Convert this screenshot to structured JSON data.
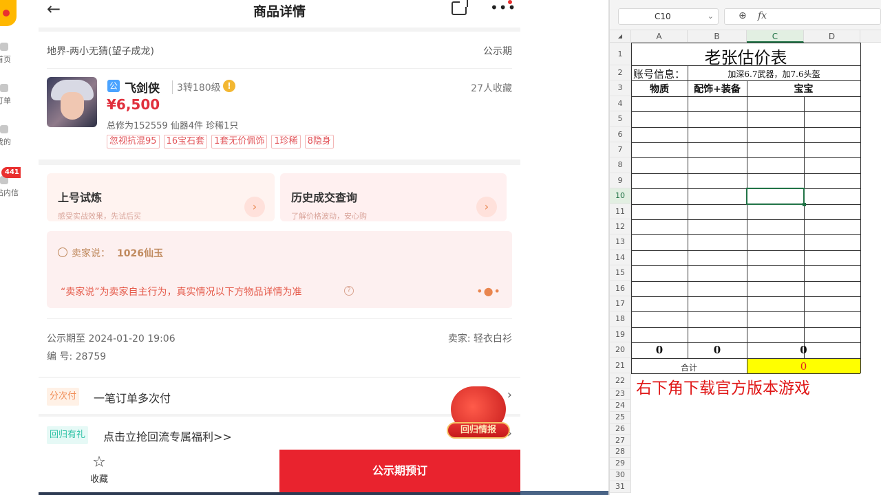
{
  "nav": {
    "items": [
      "首页",
      "订单",
      "我的",
      "站内信"
    ],
    "badge": "441"
  },
  "phone": {
    "header": {
      "title": "商品详情"
    },
    "product": {
      "region": "地界-两小无猜(望子成龙)",
      "phase": "公示期",
      "gov_icon": "公",
      "name": "飞剑侠",
      "level": "3转180级",
      "warn_icon": "!",
      "favorites": "27人收藏",
      "price": "¥6,500",
      "stats": "总修为152559  仙器4件  珍稀1只",
      "tags": [
        "忽视抗混95",
        "16宝石套",
        "1套无价佩饰",
        "1珍稀",
        "8隐身"
      ]
    },
    "services": {
      "trial_title": "上号试炼",
      "trial_sub": "感受实战效果，先试后买",
      "history_title": "历史成交查询",
      "history_sub": "了解价格波动，安心购"
    },
    "seller_note": {
      "label": "卖家说：",
      "value": "1026仙玉",
      "disclaimer": "“卖家说”为卖家自主行为，真实情况以下方物品详情为准",
      "q": "?",
      "dots": "•●•"
    },
    "meta": {
      "public_until": "公示期至 2024-01-20 19:06",
      "seller": "卖家: 轻衣白衫",
      "serial": "编 号: 28759"
    },
    "rows": [
      {
        "pill": "分次付",
        "text": "一笔订单多次付"
      },
      {
        "pill": "回归有礼",
        "text": "点击立抢回流专属福利>>"
      }
    ],
    "float_label": "回归情报",
    "bottom": {
      "fav_label": "收藏",
      "cta": "公示期预订"
    }
  },
  "sheet": {
    "name_box": "C10",
    "columns": [
      "A",
      "B",
      "C",
      "D"
    ],
    "selected_col": "C",
    "selected_row": 10,
    "rows": [
      "1",
      "2",
      "3",
      "4",
      "5",
      "6",
      "7",
      "8",
      "9",
      "10",
      "11",
      "12",
      "13",
      "14",
      "15",
      "16",
      "17",
      "18",
      "19",
      "20",
      "21",
      "22",
      "23",
      "24",
      "25",
      "26",
      "27",
      "28",
      "29",
      "30",
      "31"
    ],
    "title": "老张估价表",
    "account_label": "账号信息：",
    "account_info": "加深6.7武器，加7.6头盔",
    "headers": [
      "物质",
      "配饰+装备",
      "宝宝"
    ],
    "row20": [
      "0",
      "0",
      "0"
    ],
    "total_label": "合计",
    "total_value": "0",
    "banner": "右下角下载官方版本游戏"
  },
  "colors": {
    "accent": "#e9232e",
    "price": "#e02f3c",
    "sheet_green": "#217346",
    "highlight": "#ffff00"
  }
}
